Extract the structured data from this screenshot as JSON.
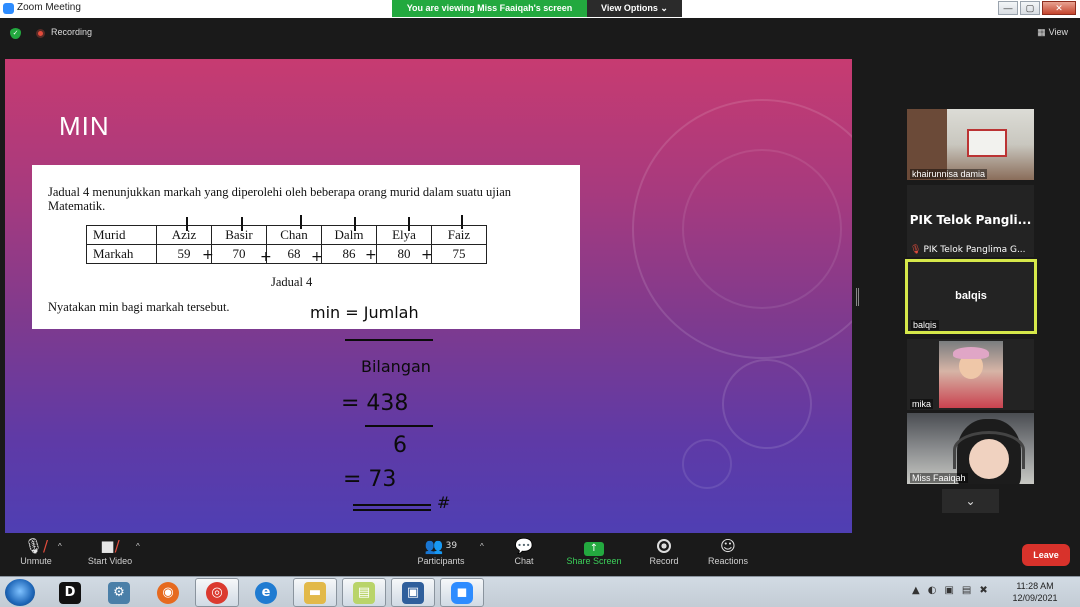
{
  "window": {
    "title": "Zoom Meeting",
    "viewing_banner": "You are viewing Miss Faaiqah's screen",
    "view_options": "View Options",
    "view_options_caret": "⌄",
    "controls": [
      "—",
      "▢",
      "✕"
    ]
  },
  "meeting": {
    "recording_label": "Recording",
    "view_label": "View"
  },
  "slide": {
    "heading": "MIN",
    "question": "Jadual 4 menunjukkan markah yang diperolehi oleh beberapa orang murid dalam suatu ujian Matematik.",
    "table": {
      "row1_label": "Murid",
      "row2_label": "Markah",
      "names": [
        "Aziz",
        "Basir",
        "Chan",
        "Dalm",
        "Elya",
        "Faiz"
      ],
      "marks": [
        "59",
        "70",
        "68",
        "86",
        "80",
        "75"
      ]
    },
    "table_caption": "Jadual 4",
    "task": "Nyatakan min bagi markah tersebut.",
    "plus_sign": "+",
    "handwriting": {
      "min_eq": "min = Jumlah",
      "bilangan": "Bilangan",
      "eq_total": "= 438",
      "divisor": "6",
      "result": "= 73",
      "hash": "#"
    }
  },
  "participants_panel": {
    "tiles": [
      {
        "name": "khairunnisa damia"
      },
      {
        "name": "PIK Telok Panglima G...",
        "big_label": "PIK Telok Pangli...",
        "muted_icon": "mic-muted-icon",
        "muted_glyph": "🎙"
      },
      {
        "name": "balqis",
        "big_label": "balqis"
      },
      {
        "name": "mika"
      },
      {
        "name": "Miss Faaiqah"
      }
    ],
    "more_chevron": "⌄"
  },
  "toolbar": {
    "unmute": "Unmute",
    "start_video": "Start Video",
    "participants": "Participants",
    "participants_count": "39",
    "chat": "Chat",
    "share_screen": "Share Screen",
    "record": "Record",
    "reactions": "Reactions",
    "leave": "Leave",
    "caret": "^",
    "icons": {
      "mic": "🎙",
      "video": "■",
      "participants": "👥",
      "chat": "💬",
      "share": "↑",
      "reactions": "☺"
    }
  },
  "taskbar": {
    "tray_icons": [
      "▲",
      "◐",
      "▣",
      "▤",
      "✖"
    ],
    "items": [
      {
        "glyph": "D"
      },
      {
        "glyph": "⚙"
      },
      {
        "glyph": "◉"
      },
      {
        "glyph": "◎"
      },
      {
        "glyph": "e"
      },
      {
        "glyph": "▬"
      },
      {
        "glyph": "▤"
      },
      {
        "glyph": "▣"
      },
      {
        "glyph": "◼"
      }
    ],
    "time": "11:28 AM",
    "date": "12/09/2021"
  },
  "colors": {
    "zoom_blue": "#2D8CFF",
    "banner_green": "#23a93f",
    "leave_red": "#d8322b",
    "active_speaker": "#d6e84a"
  }
}
